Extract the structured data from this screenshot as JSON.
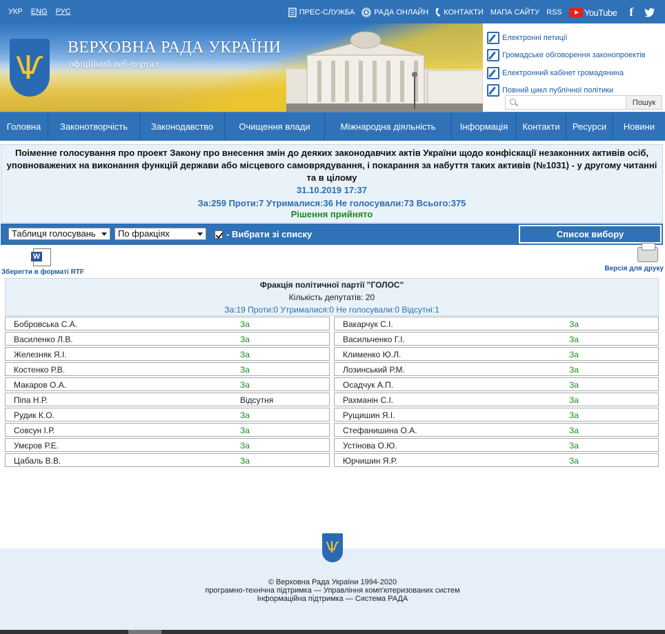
{
  "topbar": {
    "langs": [
      "УКР",
      "ENG",
      "РУС"
    ],
    "links": [
      "ПРЕС-СЛУЖБА",
      "РАДА ОНЛАЙН",
      "КОНТАКТИ",
      "МАПА САЙТУ",
      "RSS"
    ],
    "youtube": "YouTube",
    "facebook": "f",
    "twitter": "t"
  },
  "header": {
    "title": "ВЕРХОВНА РАДА УКРАЇНИ",
    "subtitle": "офіційний веб-портал",
    "side_links": [
      "Електронні петиції",
      "Громадське обговорення законопроектів",
      "Електронний кабінет громадянина",
      "Повний цикл публічної політики"
    ],
    "search_button": "Пошук",
    "search_placeholder": ""
  },
  "nav": [
    "Головна",
    "Законотворчість",
    "Законодавство",
    "Очищення влади",
    "Міжнародна діяльність",
    "Інформація",
    "Контакти",
    "Ресурси",
    "Новини"
  ],
  "vote": {
    "question": "Поіменне голосування про проект Закону про внесення змін до деяких законодавчих актів України щодо конфіскації незаконних активів осіб, уповноважених на виконання функцій держави або місцевого самоврядування, і покарання за набуття таких активів (№1031) - у другому читанні та в цілому",
    "datetime": "31.10.2019 17:37",
    "results": "За:259 Проти:7 Утрималися:36 Не голосували:73 Всього:375",
    "decision": "Рішення прийнято"
  },
  "controls": {
    "select1": "Таблиця голосувань",
    "select2": "По фракціях",
    "checkbox_label": "- Вибрати зі списку",
    "list_button": "Список вибору"
  },
  "utility": {
    "rtf_label": "Зберегти в форматі RTF",
    "word_icon_letter": "W",
    "print_label": "Версія для друку"
  },
  "faction": {
    "name": "Фракція політичної партії \"ГОЛОС\"",
    "count": "Кількість депутатів: 20",
    "results": "За:19 Проти:0 Утрималися:0 Не голосували:0 Відсутні:1"
  },
  "deputies_left": [
    {
      "name": "Бобровська С.А.",
      "vote": "За"
    },
    {
      "name": "Василенко Л.В.",
      "vote": "За"
    },
    {
      "name": "Железняк Я.І.",
      "vote": "За"
    },
    {
      "name": "Костенко Р.В.",
      "vote": "За"
    },
    {
      "name": "Макаров О.А.",
      "vote": "За"
    },
    {
      "name": "Піпа Н.Р.",
      "vote": "Відсутня"
    },
    {
      "name": "Рудик К.О.",
      "vote": "За"
    },
    {
      "name": "Совсун І.Р.",
      "vote": "За"
    },
    {
      "name": "Умєров Р.Е.",
      "vote": "За"
    },
    {
      "name": "Цабаль В.В.",
      "vote": "За"
    }
  ],
  "deputies_right": [
    {
      "name": "Вакарчук С.І.",
      "vote": "За"
    },
    {
      "name": "Васильченко Г.І.",
      "vote": "За"
    },
    {
      "name": "Клименко Ю.Л.",
      "vote": "За"
    },
    {
      "name": "Лозинський Р.М.",
      "vote": "За"
    },
    {
      "name": "Осадчук А.П.",
      "vote": "За"
    },
    {
      "name": "Рахманін С.І.",
      "vote": "За"
    },
    {
      "name": "Рущишин Я.І.",
      "vote": "За"
    },
    {
      "name": "Стефанишина О.А.",
      "vote": "За"
    },
    {
      "name": "Устінова О.Ю.",
      "vote": "За"
    },
    {
      "name": "Юрчишин Я.Р.",
      "vote": "За"
    }
  ],
  "footer": {
    "line1": "© Верховна Рада України 1994-2020",
    "line2": "програмно-технічна підтримка — Управління комп'ютеризованих систем",
    "line3": "Інформаційна підтримка — Система РАДА"
  },
  "colors": {
    "primary_blue": "#2f72b8",
    "link_blue": "#2d6db0",
    "green": "#1b8a1b",
    "panel_bg": "#e9f2f9"
  }
}
